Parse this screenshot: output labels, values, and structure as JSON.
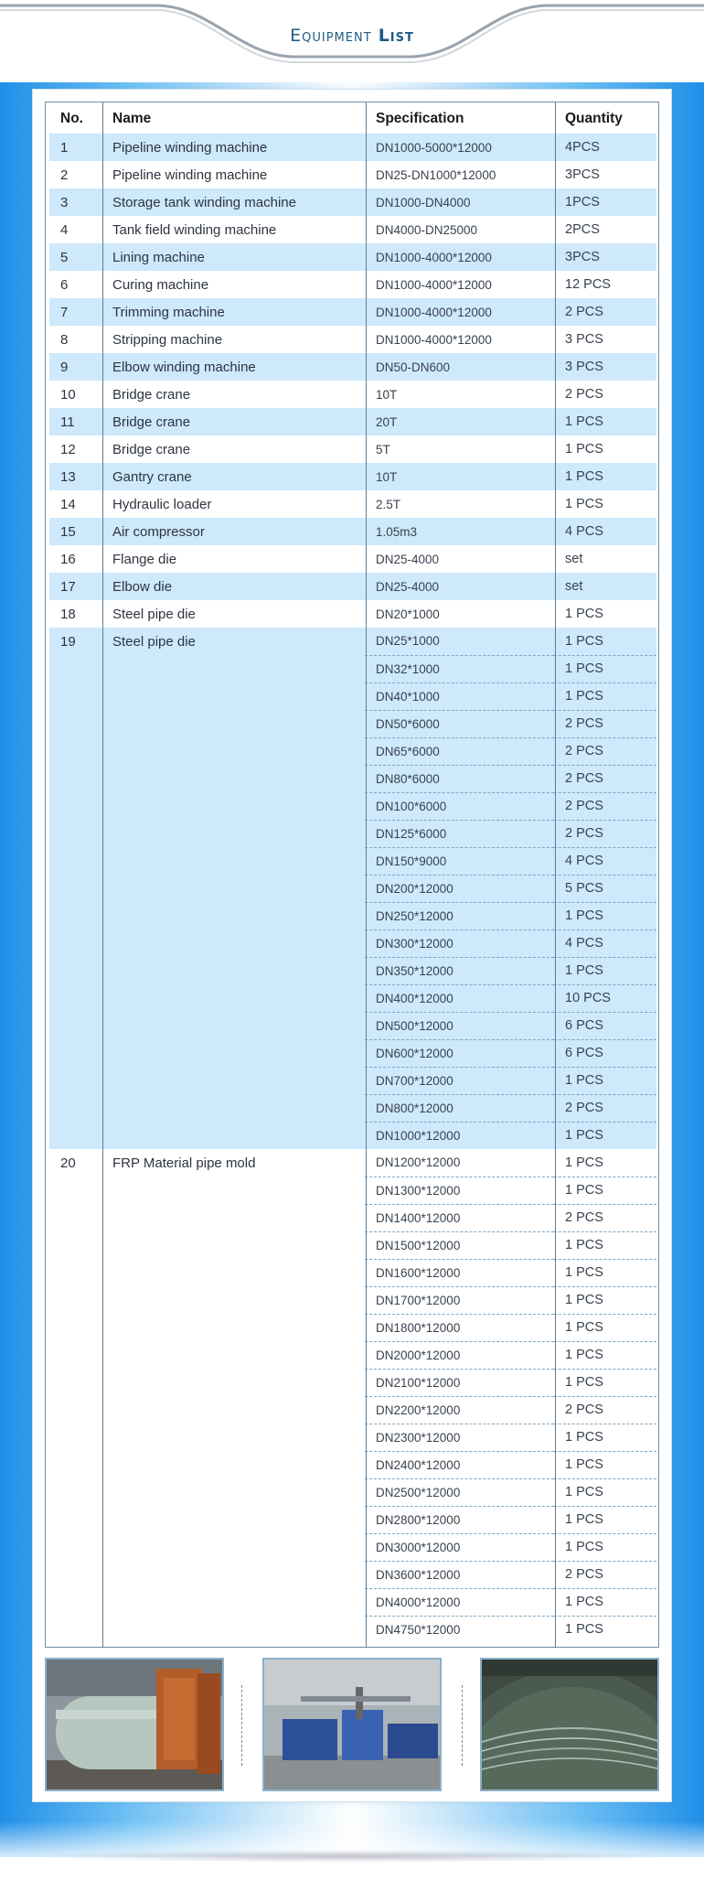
{
  "title": {
    "part1": "Equipment",
    "part2": "List"
  },
  "headers": {
    "no": "No.",
    "name": "Name",
    "spec": "Specification",
    "qty": "Quantity"
  },
  "single_rows": [
    {
      "no": "1",
      "name": "Pipeline winding machine",
      "spec": "DN1000-5000*12000",
      "qty": "4PCS"
    },
    {
      "no": "2",
      "name": "Pipeline winding machine",
      "spec": "DN25-DN1000*12000",
      "qty": "3PCS"
    },
    {
      "no": "3",
      "name": "Storage tank winding machine",
      "spec": "DN1000-DN4000",
      "qty": "1PCS"
    },
    {
      "no": "4",
      "name": "Tank field winding machine",
      "spec": "DN4000-DN25000",
      "qty": "2PCS"
    },
    {
      "no": "5",
      "name": "Lining machine",
      "spec": "DN1000-4000*12000",
      "qty": "3PCS"
    },
    {
      "no": "6",
      "name": "Curing machine",
      "spec": "DN1000-4000*12000",
      "qty": "12 PCS"
    },
    {
      "no": "7",
      "name": "Trimming machine",
      "spec": "DN1000-4000*12000",
      "qty": "2 PCS"
    },
    {
      "no": "8",
      "name": "Stripping machine",
      "spec": "DN1000-4000*12000",
      "qty": "3 PCS"
    },
    {
      "no": "9",
      "name": "Elbow winding machine",
      "spec": "DN50-DN600",
      "qty": "3 PCS"
    },
    {
      "no": "10",
      "name": "Bridge crane",
      "spec": "10T",
      "qty": "2 PCS"
    },
    {
      "no": "11",
      "name": "Bridge crane",
      "spec": "20T",
      "qty": "1 PCS"
    },
    {
      "no": "12",
      "name": "Bridge crane",
      "spec": "5T",
      "qty": "1 PCS"
    },
    {
      "no": "13",
      "name": "Gantry crane",
      "spec": "10T",
      "qty": "1 PCS"
    },
    {
      "no": "14",
      "name": "Hydraulic loader",
      "spec": "2.5T",
      "qty": "1 PCS"
    },
    {
      "no": "15",
      "name": "Air compressor",
      "spec": "1.05m3",
      "qty": "4 PCS"
    },
    {
      "no": "16",
      "name": "Flange die",
      "spec": "DN25-4000",
      "qty": "set"
    },
    {
      "no": "17",
      "name": "Elbow die",
      "spec": "DN25-4000",
      "qty": "set"
    },
    {
      "no": "18",
      "name": "Steel pipe die",
      "spec": "DN20*1000",
      "qty": "1 PCS"
    }
  ],
  "group19": {
    "no": "19",
    "name": "Steel pipe die",
    "items": [
      {
        "spec": "DN25*1000",
        "qty": "1 PCS"
      },
      {
        "spec": "DN32*1000",
        "qty": "1 PCS"
      },
      {
        "spec": "DN40*1000",
        "qty": "1 PCS"
      },
      {
        "spec": "DN50*6000",
        "qty": "2 PCS"
      },
      {
        "spec": "DN65*6000",
        "qty": "2 PCS"
      },
      {
        "spec": "DN80*6000",
        "qty": "2 PCS"
      },
      {
        "spec": "DN100*6000",
        "qty": "2 PCS"
      },
      {
        "spec": "DN125*6000",
        "qty": "2 PCS"
      },
      {
        "spec": "DN150*9000",
        "qty": "4 PCS"
      },
      {
        "spec": "DN200*12000",
        "qty": "5 PCS"
      },
      {
        "spec": "DN250*12000",
        "qty": "1 PCS"
      },
      {
        "spec": "DN300*12000",
        "qty": "4 PCS"
      },
      {
        "spec": "DN350*12000",
        "qty": "1 PCS"
      },
      {
        "spec": "DN400*12000",
        "qty": "10 PCS"
      },
      {
        "spec": "DN500*12000",
        "qty": "6 PCS"
      },
      {
        "spec": "DN600*12000",
        "qty": "6 PCS"
      },
      {
        "spec": "DN700*12000",
        "qty": "1 PCS"
      },
      {
        "spec": "DN800*12000",
        "qty": "2 PCS"
      },
      {
        "spec": "DN1000*12000",
        "qty": "1 PCS"
      }
    ]
  },
  "group20": {
    "no": "20",
    "name": "FRP Material pipe mold",
    "items": [
      {
        "spec": "DN1200*12000",
        "qty": "1 PCS"
      },
      {
        "spec": "DN1300*12000",
        "qty": "1 PCS"
      },
      {
        "spec": "DN1400*12000",
        "qty": "2 PCS"
      },
      {
        "spec": "DN1500*12000",
        "qty": "1 PCS"
      },
      {
        "spec": "DN1600*12000",
        "qty": "1 PCS"
      },
      {
        "spec": "DN1700*12000",
        "qty": "1 PCS"
      },
      {
        "spec": "DN1800*12000",
        "qty": "1 PCS"
      },
      {
        "spec": "DN2000*12000",
        "qty": "1 PCS"
      },
      {
        "spec": "DN2100*12000",
        "qty": "1 PCS"
      },
      {
        "spec": "DN2200*12000",
        "qty": "2 PCS"
      },
      {
        "spec": "DN2300*12000",
        "qty": "1 PCS"
      },
      {
        "spec": "DN2400*12000",
        "qty": "1 PCS"
      },
      {
        "spec": "DN2500*12000",
        "qty": "1 PCS"
      },
      {
        "spec": "DN2800*12000",
        "qty": "1 PCS"
      },
      {
        "spec": "DN3000*12000",
        "qty": "1 PCS"
      },
      {
        "spec": "DN3600*12000",
        "qty": "2 PCS"
      },
      {
        "spec": "DN4000*12000",
        "qty": "1 PCS"
      },
      {
        "spec": "DN4750*12000",
        "qty": "1 PCS"
      }
    ]
  },
  "photos": [
    {
      "icon": "winding-machine-photo"
    },
    {
      "icon": "factory-floor-photo"
    },
    {
      "icon": "frp-pipe-photo"
    }
  ],
  "colors": {
    "row_blue": "#cde9fb",
    "accent": "#1d5b86",
    "border": "#5b7f99"
  }
}
